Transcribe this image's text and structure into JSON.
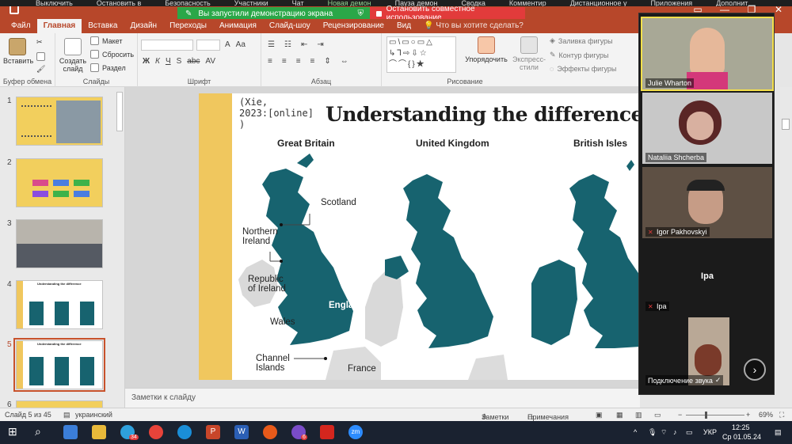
{
  "zoom_top": {
    "items": [
      "Выключить",
      "Остановить в",
      "Безопасность",
      "Участники",
      "Чат",
      "Новая демон",
      "Пауза демон",
      "Сводка",
      "Комментир",
      "Дистанционное у",
      "Приложения",
      "Дополнит"
    ]
  },
  "share": {
    "banner": "Вы запустили демонстрацию экрана",
    "stop": "Остановить совместное использование"
  },
  "window": {
    "minimize": "—",
    "maximize": "❐",
    "close": "✕"
  },
  "tabs": [
    "Файл",
    "Главная",
    "Вставка",
    "Дизайн",
    "Переходы",
    "Анимация",
    "Слайд-шоу",
    "Рецензирование",
    "Вид",
    "Что вы хотите сделать?"
  ],
  "ribbon": {
    "paste": "Вставить",
    "clipboard_group": "Буфер обмена",
    "new_slide": "Создать слайд",
    "layout": "Макет",
    "reset": "Сбросить",
    "section": "Раздел",
    "slides_group": "Слайды",
    "font_group": "Шрифт",
    "paragraph_group": "Абзац",
    "arrange": "Упорядочить",
    "quick_styles": "Экспресс-стили",
    "drawing_group": "Рисование",
    "shape_fill": "Заливка фигуры",
    "shape_outline": "Контур фигуры",
    "shape_effects": "Эффекты фигуры",
    "font_buttons": [
      "Ж",
      "К",
      "Ч",
      "S",
      "abc",
      "AV",
      "Aa",
      "A"
    ],
    "para_buttons": [
      "≡",
      "≡",
      "≡",
      "≡",
      "⇕",
      "⇔"
    ]
  },
  "thumbnails": [
    {
      "num": "1",
      "style": "th1"
    },
    {
      "num": "2",
      "style": "th2"
    },
    {
      "num": "3",
      "style": "th3"
    },
    {
      "num": "4",
      "style": "th4"
    },
    {
      "num": "5",
      "style": "th5",
      "active": true
    },
    {
      "num": "6",
      "style": "th2"
    }
  ],
  "slide": {
    "citation": "(Xie,\n2023:[online]\n)",
    "title": "Understanding the difference",
    "headings": [
      "Great Britain",
      "United Kingdom",
      "British Isles"
    ],
    "labels": {
      "scotland": "Scotland",
      "northern_ireland": "Northern\nIreland",
      "republic": "Republic\nof Ireland",
      "england": "England",
      "wales": "Wales",
      "channel": "Channel\nIslands",
      "france": "France"
    }
  },
  "thumb_texts": {
    "t4_title": "Understanding the difference",
    "t5_title": "Understanding the difference"
  },
  "notes": "Заметки к слайду",
  "participants": [
    {
      "name": "Julie Wharton",
      "muted": false,
      "speaking": true
    },
    {
      "name": "Nataliia Shcherba",
      "muted": false
    },
    {
      "name": "Igor Pakhovskyi",
      "muted": true
    },
    {
      "name": "Ipa",
      "muted": true,
      "center": "Ipa"
    },
    {
      "name": "Подключение звука",
      "muted": false
    }
  ],
  "statusbar": {
    "slide_info": "Слайд 5 из 45",
    "language": "украинский",
    "notes": "Заметки",
    "comments": "Примечания",
    "zoom": "69%",
    "zoom_minus": "−",
    "zoom_plus": "+"
  },
  "taskbar": {
    "tray_lang": "УКР",
    "time": "12:25",
    "date": "Ср 01.05.24",
    "chevron": "^",
    "telegram_badge": "34",
    "viber_badge": "6",
    "word_letter": "W",
    "ppt_letter": "P",
    "zoom_letters": "zm"
  },
  "colors": {
    "accent": "#b7472a",
    "map": "#17636f",
    "slide_band": "#f0c75e",
    "share_green": "#2aa748",
    "stop_red": "#e23b3b"
  }
}
